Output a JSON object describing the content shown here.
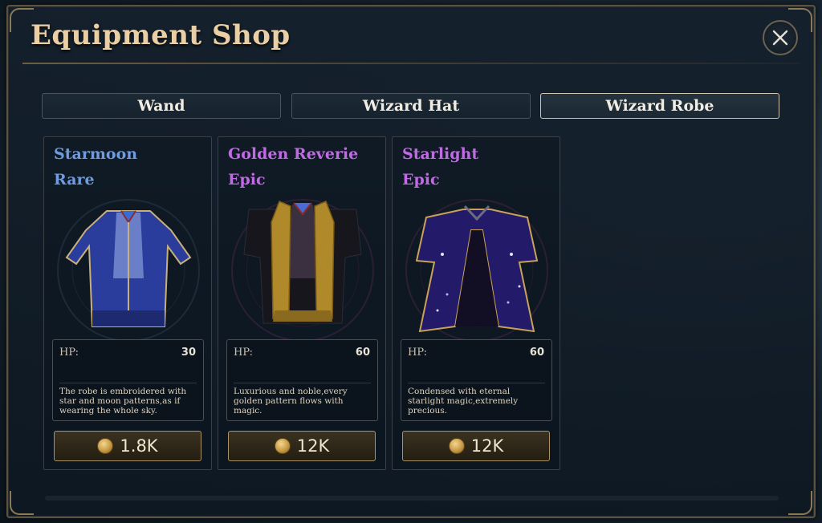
{
  "window": {
    "title": "Equipment Shop"
  },
  "close": {
    "icon": "close-icon"
  },
  "tabs": [
    {
      "label": "Wand",
      "active": false
    },
    {
      "label": "Wizard Hat",
      "active": false
    },
    {
      "label": "Wizard Robe",
      "active": true
    }
  ],
  "items": [
    {
      "name": "Starmoon",
      "rarity": "Rare",
      "rarity_color": "#6f9be0",
      "hp_label": "HP:",
      "hp": "30",
      "description": "The robe is embroidered with star and moon patterns,as if wearing the whole sky.",
      "price": "1.8K",
      "icon": "blue-robe-icon"
    },
    {
      "name": "Golden Reverie",
      "rarity": "Epic",
      "rarity_color": "#c26ae6",
      "hp_label": "HP:",
      "hp": "60",
      "description": "Luxurious and noble,every golden pattern flows with magic.",
      "price": "12K",
      "icon": "gold-robe-icon"
    },
    {
      "name": "Starlight",
      "rarity": "Epic",
      "rarity_color": "#c26ae6",
      "hp_label": "HP:",
      "hp": "60",
      "description": "Condensed with eternal starlight magic,extremely precious.",
      "price": "12K",
      "icon": "starlight-robe-icon"
    }
  ],
  "colors": {
    "accent_gold": "#a99367",
    "rare": "#6f9be0",
    "epic": "#c26ae6"
  }
}
